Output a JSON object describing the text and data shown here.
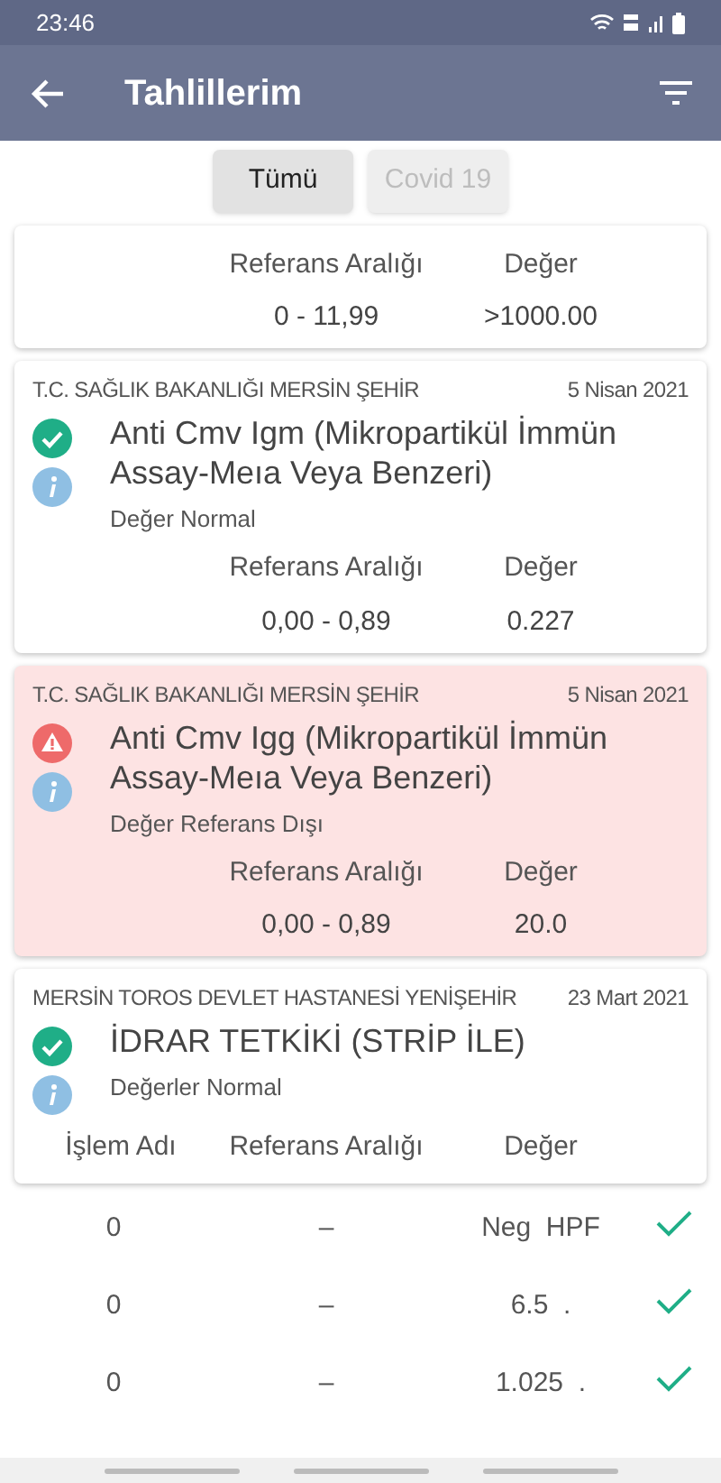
{
  "status_bar": {
    "time": "23:46"
  },
  "app_bar": {
    "title": "Tahlillerim"
  },
  "filter_tabs": [
    {
      "label": "Tümü",
      "selected": true
    },
    {
      "label": "Covid 19",
      "selected": false
    }
  ],
  "results": [
    {
      "columns": [
        "Referans Aralığı",
        "Değer"
      ],
      "values": [
        "0 - 11,99",
        ">1000.00"
      ]
    },
    {
      "institution": "T.C. SAĞLIK BAKANLIĞI MERSİN ŞEHİR",
      "date": "5 Nisan 2021",
      "title": "Anti Cmv Igm (Mikropartikül İmmün Assay-Meıa Veya Benzeri)",
      "out_of_range": false,
      "note": "Değer Normal",
      "columns": [
        "Referans Aralığı",
        "Değer"
      ],
      "values": [
        "0,00 - 0,89",
        "0.227"
      ]
    },
    {
      "institution": "T.C. SAĞLIK BAKANLIĞI MERSİN ŞEHİR",
      "date": "5 Nisan 2021",
      "title": "Anti Cmv Igg (Mikropartikül İmmün Assay-Meıa Veya Benzeri)",
      "out_of_range": true,
      "note": "Değer Referans Dışı",
      "columns": [
        "Referans Aralığı",
        "Değer"
      ],
      "values": [
        "0,00 - 0,89",
        "20.0"
      ]
    },
    {
      "institution": "MERSİN TOROS DEVLET HASTANESİ YENİŞEHİR",
      "date": "23 Mart 2021",
      "title": "İDRAR TETKİKİ (STRİP İLE)",
      "out_of_range": false,
      "note": "Değerler Normal",
      "columns": [
        "İşlem Adı",
        "Referans Aralığı",
        "Değer"
      ]
    }
  ],
  "detail_rows": [
    {
      "name": "0",
      "range": "–",
      "value": "Neg",
      "unit": "HPF",
      "ok": true
    },
    {
      "name": "0",
      "range": "–",
      "value": "6.5",
      "unit": ".",
      "ok": true
    },
    {
      "name": "0",
      "range": "–",
      "value": "1.025",
      "unit": ".",
      "ok": true
    }
  ]
}
